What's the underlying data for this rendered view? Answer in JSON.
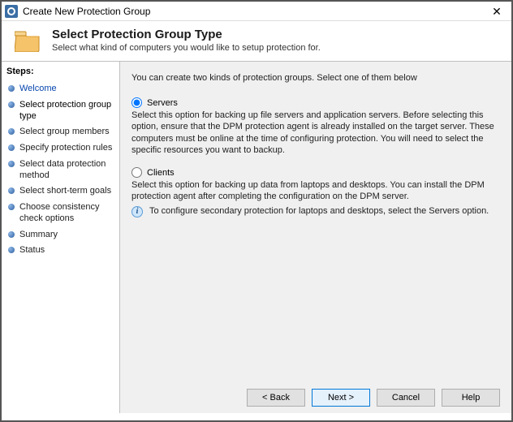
{
  "window": {
    "title": "Create New Protection Group",
    "close_label": "✕"
  },
  "header": {
    "title": "Select Protection Group Type",
    "subtitle": "Select what kind of computers you would like to setup protection for."
  },
  "sidebar": {
    "title": "Steps:",
    "steps": [
      {
        "label": "Welcome",
        "state": "visited"
      },
      {
        "label": "Select protection group type",
        "state": "active"
      },
      {
        "label": "Select group members",
        "state": "future"
      },
      {
        "label": "Specify protection rules",
        "state": "future"
      },
      {
        "label": "Select data protection method",
        "state": "future"
      },
      {
        "label": "Select short-term goals",
        "state": "future"
      },
      {
        "label": "Choose consistency check options",
        "state": "future"
      },
      {
        "label": "Summary",
        "state": "future"
      },
      {
        "label": "Status",
        "state": "future"
      }
    ]
  },
  "main": {
    "intro": "You can create two kinds of protection groups. Select one of them below",
    "options": {
      "servers": {
        "label": "Servers",
        "selected": true,
        "description": "Select this option for backing up file servers and application servers. Before selecting this option, ensure that the DPM protection agent is already installed on the target server. These computers must be online at the time of configuring protection. You will need to select the specific resources you want to backup."
      },
      "clients": {
        "label": "Clients",
        "selected": false,
        "description": "Select this option for backing up data from laptops and desktops. You can install the DPM protection agent after completing the configuration on the DPM server.",
        "info": "To configure secondary protection for laptops and desktops, select the Servers option."
      }
    },
    "buttons": {
      "back": "< Back",
      "next": "Next >",
      "cancel": "Cancel",
      "help": "Help"
    }
  }
}
